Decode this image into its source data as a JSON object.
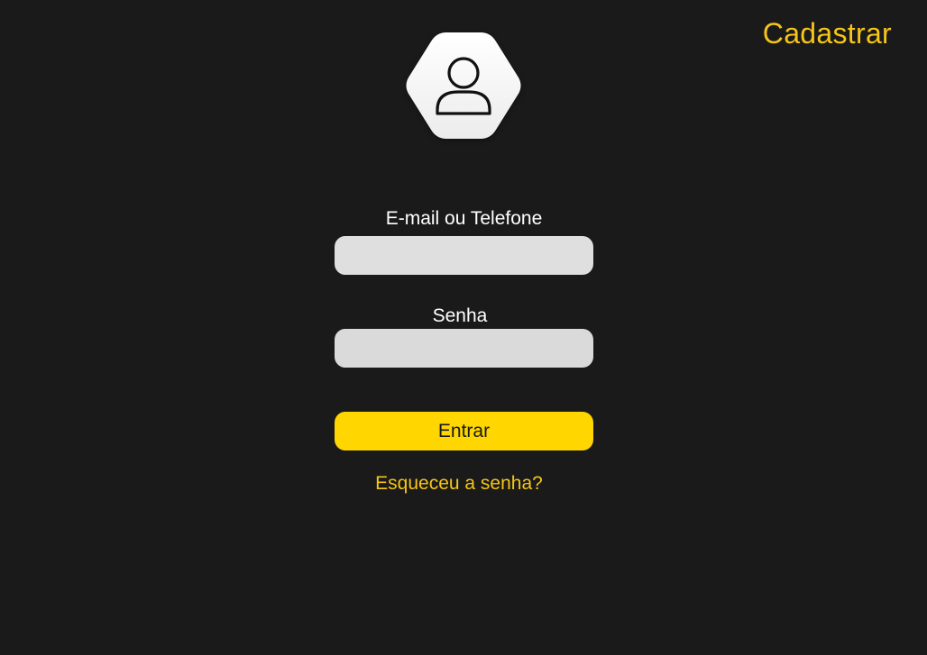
{
  "header": {
    "register_label": "Cadastrar"
  },
  "avatar": {
    "icon": "user-icon"
  },
  "form": {
    "email_label": "E-mail ou Telefone",
    "email_value": "",
    "email_placeholder": "",
    "password_label": "Senha",
    "password_value": "",
    "password_placeholder": "",
    "submit_label": "Entrar",
    "forgot_label": "Esqueceu a senha?"
  },
  "colors": {
    "background": "#1a1a1a",
    "accent": "#ffd600",
    "link": "#f5c518",
    "input_background": "#e0dfe0"
  }
}
